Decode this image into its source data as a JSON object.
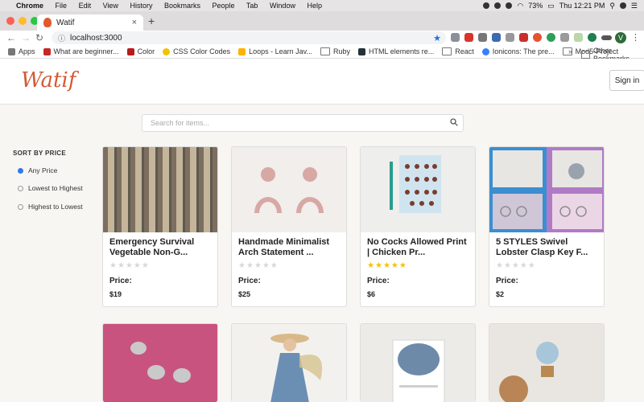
{
  "mac_menu": {
    "items": [
      "Chrome",
      "File",
      "Edit",
      "View",
      "History",
      "Bookmarks",
      "People",
      "Tab",
      "Window",
      "Help"
    ],
    "battery": "73%",
    "clock": "Thu 12:21 PM"
  },
  "tab": {
    "title": "Watif"
  },
  "address_bar": {
    "url": "localhost:3000"
  },
  "profile_initial": "V",
  "bookmarks": {
    "items": [
      "Apps",
      "What are beginner...",
      "Color",
      "CSS Color Codes",
      "Loops - Learn Jav...",
      "Ruby",
      "HTML elements re...",
      "React",
      "Ionicons: The pre...",
      "Mod5-Project"
    ],
    "more": "»",
    "other": "Other Bookmarks"
  },
  "site": {
    "logo": "Watif",
    "sign_in": "Sign in",
    "search_placeholder": "Search for items..."
  },
  "sort": {
    "title": "SORT BY PRICE",
    "options": [
      "Any Price",
      "Lowest to Highest",
      "Highest to Lowest"
    ],
    "selected": 0
  },
  "products": [
    {
      "name": "Emergency Survival Vegetable Non-G...",
      "rating": 0,
      "price_label": "Price:",
      "price": "$19"
    },
    {
      "name": "Handmade Minimalist Arch Statement ...",
      "rating": 0,
      "price_label": "Price:",
      "price": "$25"
    },
    {
      "name": "No Cocks Allowed Print | Chicken Pr...",
      "rating": 5,
      "price_label": "Price:",
      "price": "$6"
    },
    {
      "name": "5 STYLES Swivel Lobster Clasp Key F...",
      "rating": 0,
      "price_label": "Price:",
      "price": "$2"
    }
  ],
  "colors": {
    "accent": "#d35a35",
    "radio": "#2d7be5",
    "star": "#f4c20d"
  }
}
